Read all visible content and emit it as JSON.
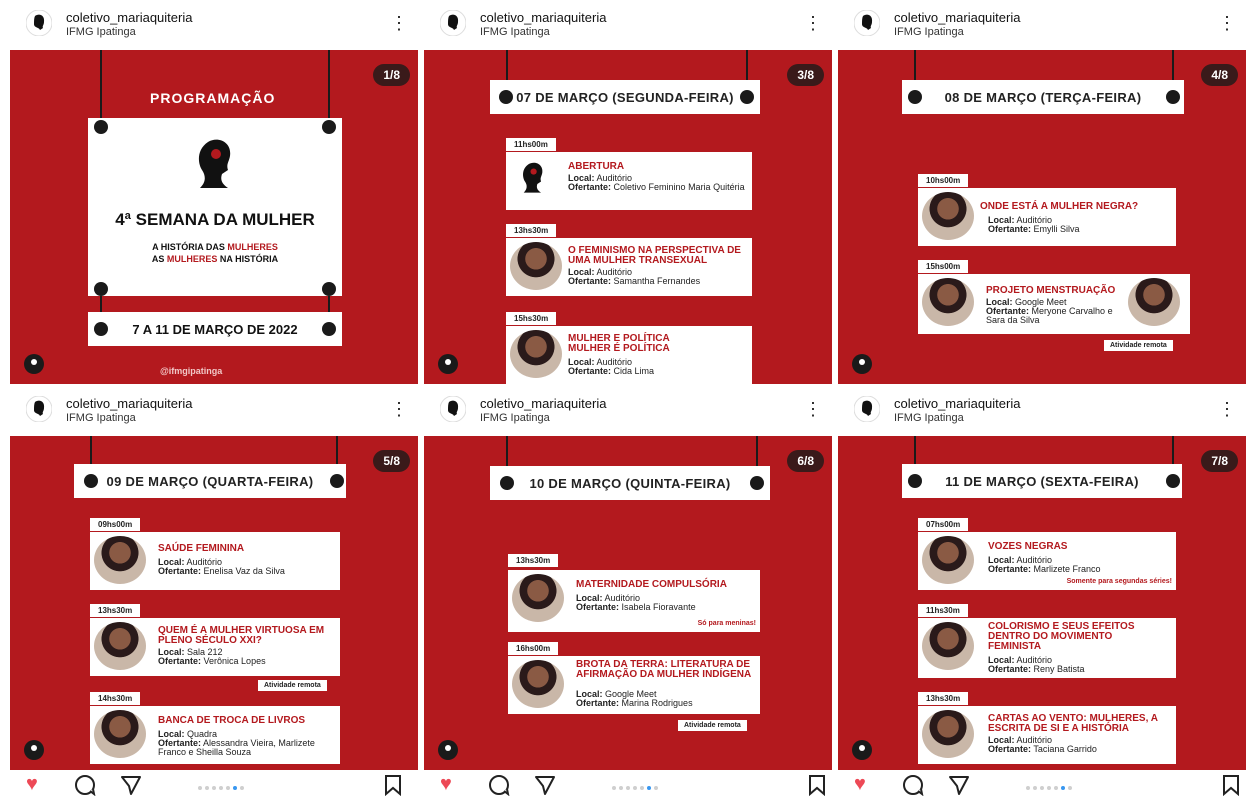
{
  "account": {
    "username": "coletivo_mariaquiteria",
    "location": "IFMG Ipatinga"
  },
  "posts": [
    {
      "counter": "1/8",
      "heading": "PROGRAMAÇÃO",
      "title": "4ª SEMANA DA MULHER",
      "sub1a": "A HISTÓRIA DAS ",
      "sub1b": "MULHERES",
      "sub2a": "AS ",
      "sub2b": "MULHERES",
      "sub2c": " NA HISTÓRIA",
      "date": "7 A 11 DE MARÇO DE 2022",
      "handle": "@ifmgipatinga"
    },
    {
      "counter": "3/8",
      "day": "07 DE MARÇO (SEGUNDA-FEIRA)",
      "events": [
        {
          "time": "11hs00m",
          "title": "ABERTURA",
          "local": "Auditório",
          "ofertante": "Coletivo Feminino Maria Quitéria"
        },
        {
          "time": "13hs30m",
          "title": "O FEMINISMO NA PERSPECTIVA DE UMA MULHER TRANSEXUAL",
          "local": "Auditório",
          "ofertante": "Samantha Fernandes"
        },
        {
          "time": "15hs30m",
          "title": "MULHER E POLÍTICA MULHER É POLÍTICA",
          "local": "Auditório",
          "ofertante": "Cida Lima"
        }
      ]
    },
    {
      "counter": "4/8",
      "day": "08 DE MARÇO (TERÇA-FEIRA)",
      "events": [
        {
          "time": "10hs00m",
          "title": "ONDE ESTÁ A MULHER NEGRA?",
          "local": "Auditório",
          "ofertante": "Emylli Silva"
        },
        {
          "time": "15hs00m",
          "title": "PROJETO MENSTRUAÇÃO",
          "local": "Google Meet",
          "ofertante": "Meryone Carvalho e Sara da Silva",
          "remote": "Atividade remota"
        }
      ]
    },
    {
      "counter": "5/8",
      "day": "09 DE MARÇO (QUARTA-FEIRA)",
      "events": [
        {
          "time": "09hs00m",
          "title": "SAÚDE FEMININA",
          "local": "Auditório",
          "ofertante": "Enelisa Vaz da Silva"
        },
        {
          "time": "13hs30m",
          "title": "QUEM É A MULHER VIRTUOSA EM PLENO SÉCULO XXI?",
          "local": "Sala 212",
          "ofertante": "Verônica Lopes",
          "remote": "Atividade remota"
        },
        {
          "time": "14hs30m",
          "title": "BANCA DE TROCA DE LIVROS",
          "local": "Quadra",
          "ofertante": "Alessandra Vieira, Marlizete Franco e Sheilla Souza"
        }
      ]
    },
    {
      "counter": "6/8",
      "day": "10 DE MARÇO (QUINTA-FEIRA)",
      "events": [
        {
          "time": "13hs30m",
          "title": "MATERNIDADE COMPULSÓRIA",
          "local": "Auditório",
          "ofertante": "Isabela Fioravante",
          "note": "Só para meninas!"
        },
        {
          "time": "16hs00m",
          "title": "BROTA DA TERRA: LITERATURA DE AFIRMAÇÃO DA MULHER INDÍGENA",
          "local": "Google Meet",
          "ofertante": "Marina Rodrigues",
          "remote": "Atividade remota"
        }
      ]
    },
    {
      "counter": "7/8",
      "day": "11 DE MARÇO (SEXTA-FEIRA)",
      "events": [
        {
          "time": "07hs00m",
          "title": "VOZES NEGRAS",
          "local": "Auditório",
          "ofertante": "Marlizete Franco",
          "note": "Somente para segundas séries!"
        },
        {
          "time": "11hs30m",
          "title": "COLORISMO E SEUS EFEITOS DENTRO DO MOVIMENTO FEMINISTA",
          "local": "Auditório",
          "ofertante": "Reny Batista"
        },
        {
          "time": "13hs30m",
          "title": "CARTAS AO VENTO: MULHERES, A ESCRITA DE SI E A HISTÓRIA",
          "local": "Auditório",
          "ofertante": "Taciana Garrido"
        }
      ]
    }
  ],
  "labels": {
    "local": "Local:",
    "ofertante": "Ofertante:"
  },
  "colors": {
    "slide_bg": "#b3191e",
    "accent_text": "#b3191e",
    "like": "#ed4956",
    "active_dot": "#3897f0"
  },
  "icons": {
    "like": "heart-icon",
    "comment": "comment-icon",
    "share": "send-icon",
    "save": "bookmark-icon",
    "more": "more-options-icon"
  }
}
